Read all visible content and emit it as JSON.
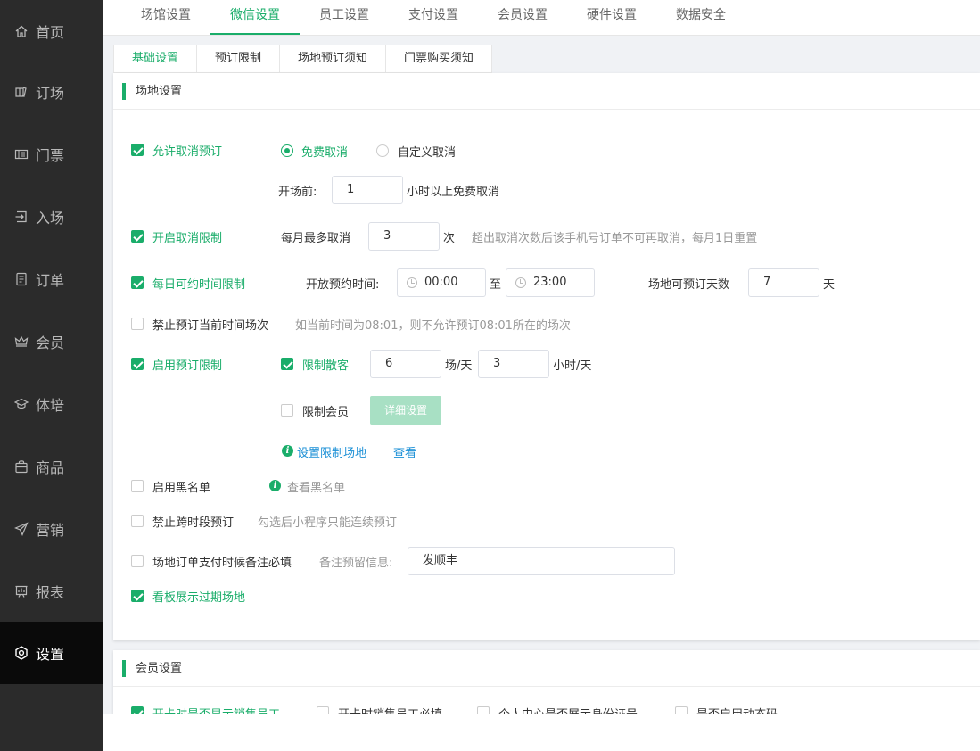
{
  "sidebar": {
    "items": [
      {
        "label": "首页",
        "icon": "home-icon"
      },
      {
        "label": "订场",
        "icon": "book-icon"
      },
      {
        "label": "门票",
        "icon": "ticket-icon"
      },
      {
        "label": "入场",
        "icon": "enter-icon"
      },
      {
        "label": "订单",
        "icon": "order-icon"
      },
      {
        "label": "会员",
        "icon": "crown-icon"
      },
      {
        "label": "体培",
        "icon": "training-icon"
      },
      {
        "label": "商品",
        "icon": "bag-icon"
      },
      {
        "label": "营销",
        "icon": "send-icon"
      },
      {
        "label": "报表",
        "icon": "chart-icon"
      },
      {
        "label": "设置",
        "icon": "settings-icon"
      }
    ],
    "active_index": 10
  },
  "top_tabs": [
    "场馆设置",
    "微信设置",
    "员工设置",
    "支付设置",
    "会员设置",
    "硬件设置",
    "数据安全"
  ],
  "sub_tabs": [
    "基础设置",
    "预订限制",
    "场地预订须知",
    "门票购买须知"
  ],
  "venue": {
    "title": "场地设置",
    "allow_cancel": {
      "label": "允许取消预订",
      "checked": true
    },
    "free_cancel": "免费取消",
    "custom_cancel": "自定义取消",
    "before_label": "开场前:",
    "before_value": "1",
    "before_suffix": "小时以上免费取消",
    "cancel_limit": {
      "label": "开启取消限制",
      "checked": true
    },
    "monthly_max_label": "每月最多取消",
    "monthly_max_value": "3",
    "monthly_unit": "次",
    "monthly_hint": "超出取消次数后该手机号订单不可再取消，每月1日重置",
    "daily_limit": {
      "label": "每日可约时间限制",
      "checked": true
    },
    "open_time_label": "开放预约时间:",
    "start_time": "00:00",
    "to": "至",
    "end_time": "23:00",
    "days_label": "场地可预订天数",
    "days_value": "7",
    "days_unit": "天",
    "forbid_current": {
      "label": "禁止预订当前时间场次",
      "checked": false
    },
    "forbid_current_hint": "如当前时间为08:01，则不允许预订08:01所在的场次",
    "booking_limit": {
      "label": "启用预订限制",
      "checked": true
    },
    "limit_guest": {
      "label": "限制散客",
      "checked": true
    },
    "guest_sessions": "6",
    "sessions_unit": "场/天",
    "guest_hours": "3",
    "hours_unit": "小时/天",
    "limit_member": {
      "label": "限制会员",
      "checked": false
    },
    "detail_button": "详细设置",
    "set_limit_venue": "设置限制场地",
    "view": "查看",
    "blacklist": {
      "label": "启用黑名单",
      "checked": false
    },
    "view_blacklist": "查看黑名单",
    "forbid_cross": {
      "label": "禁止跨时段预订",
      "checked": false
    },
    "forbid_cross_hint": "勾选后小程序只能连续预订",
    "remark_required": {
      "label": "场地订单支付时候备注必填",
      "checked": false
    },
    "remark_label": "备注预留信息:",
    "remark_value": "发顺丰",
    "board_expired": {
      "label": "看板展示过期场地",
      "checked": true
    }
  },
  "member": {
    "title": "会员设置",
    "show_sales": {
      "label": "开卡时是否显示销售员工",
      "checked": true
    },
    "sales_required": {
      "label": "开卡时销售员工必填",
      "checked": false
    },
    "show_id": {
      "label": "个人中心是否展示身份证号",
      "checked": false
    },
    "dynamic_code": {
      "label": "是否启用动态码",
      "checked": false
    }
  },
  "colors": {
    "accent": "#1aad6a",
    "link": "#1a8fd6",
    "sidebar": "#2b2b2b"
  }
}
